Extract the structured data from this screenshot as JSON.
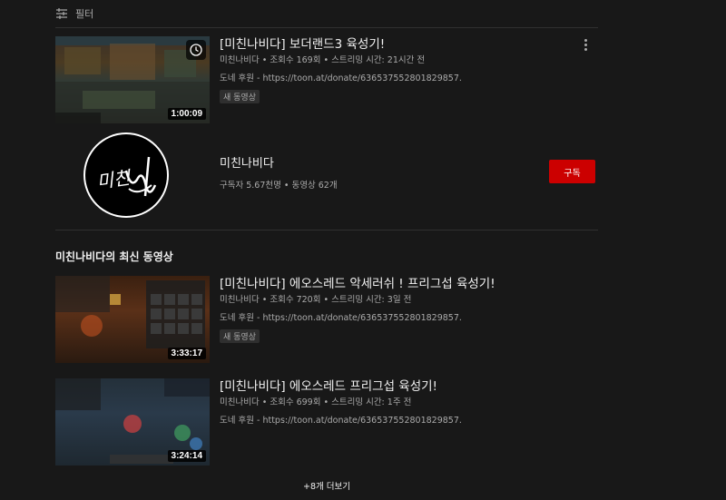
{
  "filter": {
    "label": "필터",
    "icon": "filter-sliders-icon"
  },
  "videos": [
    {
      "title": "[미친나비다] 보더랜드3 육성기!",
      "meta": "미친나비다 • 조회수 169회 • 스트리밍 시간: 21시간 전",
      "desc": "도네 후원 - https://toon.at/donate/636537552801829857.",
      "badge": "새 동영상",
      "duration": "1:00:09"
    }
  ],
  "channel": {
    "name": "미친나비다",
    "meta": "구독자 5.67천명 • 동영상 62개",
    "subscribe_label": "구독",
    "avatar_text": "미친나비"
  },
  "section_title": "미친나비다의 최신 동영상",
  "latest": [
    {
      "title": "[미친나비다] 에오스레드 악세러쉬 ! 프리그섭 육성기!",
      "meta": "미친나비다 • 조회수 720회 • 스트리밍 시간: 3일 전",
      "desc": "도네 후원 - https://toon.at/donate/636537552801829857.",
      "badge": "새 동영상",
      "duration": "3:33:17"
    },
    {
      "title": "[미친나비다] 에오스레드 프리그섭 육성기!",
      "meta": "미친나비다 • 조회수 699회 • 스트리밍 시간: 1주 전",
      "desc": "도네 후원 - https://toon.at/donate/636537552801829857.",
      "duration": "3:24:14"
    }
  ],
  "show_more": "+8개 더보기",
  "colors": {
    "background": "#181818",
    "subscribe": "#cc0000",
    "text_secondary": "#aaaaaa"
  }
}
